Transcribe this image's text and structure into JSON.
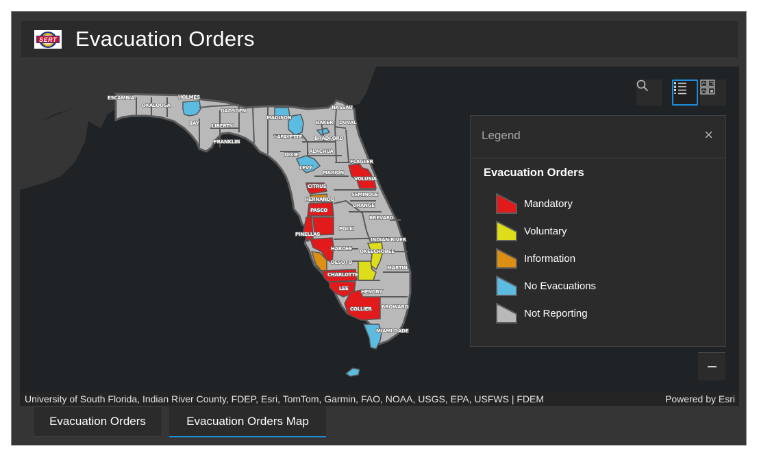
{
  "header": {
    "title": "Evacuation Orders",
    "logo_text": "SERT"
  },
  "map": {
    "colors": {
      "background_water": "#1f2326",
      "land_other": "#353535",
      "Mandatory": "#e31a1c",
      "Voluntary": "#dddd1a",
      "Information": "#dc8f12",
      "No Evacuations": "#5cbbe0",
      "Not Reporting": "#b9b9b9",
      "county_border": "#565656"
    },
    "county_labels": [
      {
        "name": "ESCAMBIA",
        "status": "Not Reporting"
      },
      {
        "name": "OKALOOSA",
        "status": "Not Reporting"
      },
      {
        "name": "HOLMES",
        "status": "No Evacuations"
      },
      {
        "name": "BAY",
        "status": "Not Reporting"
      },
      {
        "name": "GADSDEN",
        "status": "Not Reporting"
      },
      {
        "name": "LIBERTY",
        "status": "Not Reporting"
      },
      {
        "name": "FRANKLIN",
        "status": "Not Reporting"
      },
      {
        "name": "MADISON",
        "status": "No Evacuations"
      },
      {
        "name": "LAFAYETTE",
        "status": "Not Reporting"
      },
      {
        "name": "DIXIE",
        "status": "Not Reporting"
      },
      {
        "name": "LEVY",
        "status": "No Evacuations"
      },
      {
        "name": "BAKER",
        "status": "Not Reporting"
      },
      {
        "name": "NASSAU",
        "status": "Not Reporting"
      },
      {
        "name": "DUVAL",
        "status": "Not Reporting"
      },
      {
        "name": "BRADFORD",
        "status": "No Evacuations"
      },
      {
        "name": "ALACHUA",
        "status": "Not Reporting"
      },
      {
        "name": "MARION",
        "status": "Not Reporting"
      },
      {
        "name": "FLAGLER",
        "status": "Not Reporting"
      },
      {
        "name": "VOLUSIA",
        "status": "Mandatory"
      },
      {
        "name": "CITRUS",
        "status": "Mandatory"
      },
      {
        "name": "HERNANDO",
        "status": "Information"
      },
      {
        "name": "PASCO",
        "status": "Mandatory"
      },
      {
        "name": "SEMINOLE",
        "status": "Not Reporting"
      },
      {
        "name": "ORANGE",
        "status": "Not Reporting"
      },
      {
        "name": "BREVARD",
        "status": "Not Reporting"
      },
      {
        "name": "PINELLAS",
        "status": "Mandatory"
      },
      {
        "name": "POLK",
        "status": "Not Reporting"
      },
      {
        "name": "INDIAN RIVER",
        "status": "Not Reporting"
      },
      {
        "name": "HARDEE",
        "status": "Not Reporting"
      },
      {
        "name": "OKEECHOBEE",
        "status": "Voluntary"
      },
      {
        "name": "DESOTO",
        "status": "Not Reporting"
      },
      {
        "name": "MARTIN",
        "status": "Not Reporting"
      },
      {
        "name": "CHARLOTTE",
        "status": "Mandatory"
      },
      {
        "name": "LEE",
        "status": "Mandatory"
      },
      {
        "name": "HENDRY",
        "status": "Not Reporting"
      },
      {
        "name": "BROWARD",
        "status": "Not Reporting"
      },
      {
        "name": "COLLIER",
        "status": "Mandatory"
      },
      {
        "name": "MIAMI-DADE",
        "status": "Not Reporting"
      }
    ],
    "attribution": "University of South Florida, Indian River County, FDEP, Esri, TomTom, Garmin, FAO, NOAA, USGS, EPA, USFWS | FDEM",
    "powered_by": "Powered by Esri"
  },
  "toolbar": {
    "search_icon": "search-icon",
    "legend_icon": "legend-list-icon",
    "basemap_icon": "basemap-gallery-icon"
  },
  "legend": {
    "title": "Legend",
    "close_icon": "×",
    "layer_title": "Evacuation Orders",
    "items": [
      {
        "label": "Mandatory",
        "color": "#e31a1c"
      },
      {
        "label": "Voluntary",
        "color": "#dddd1a"
      },
      {
        "label": "Information",
        "color": "#dc8f12"
      },
      {
        "label": "No Evacuations",
        "color": "#5cbbe0"
      },
      {
        "label": "Not Reporting",
        "color": "#b9b9b9"
      }
    ]
  },
  "zoom_out_icon": "minus-icon",
  "tabs": [
    {
      "label": "Evacuation Orders",
      "active": false
    },
    {
      "label": "Evacuation Orders Map",
      "active": true
    }
  ]
}
